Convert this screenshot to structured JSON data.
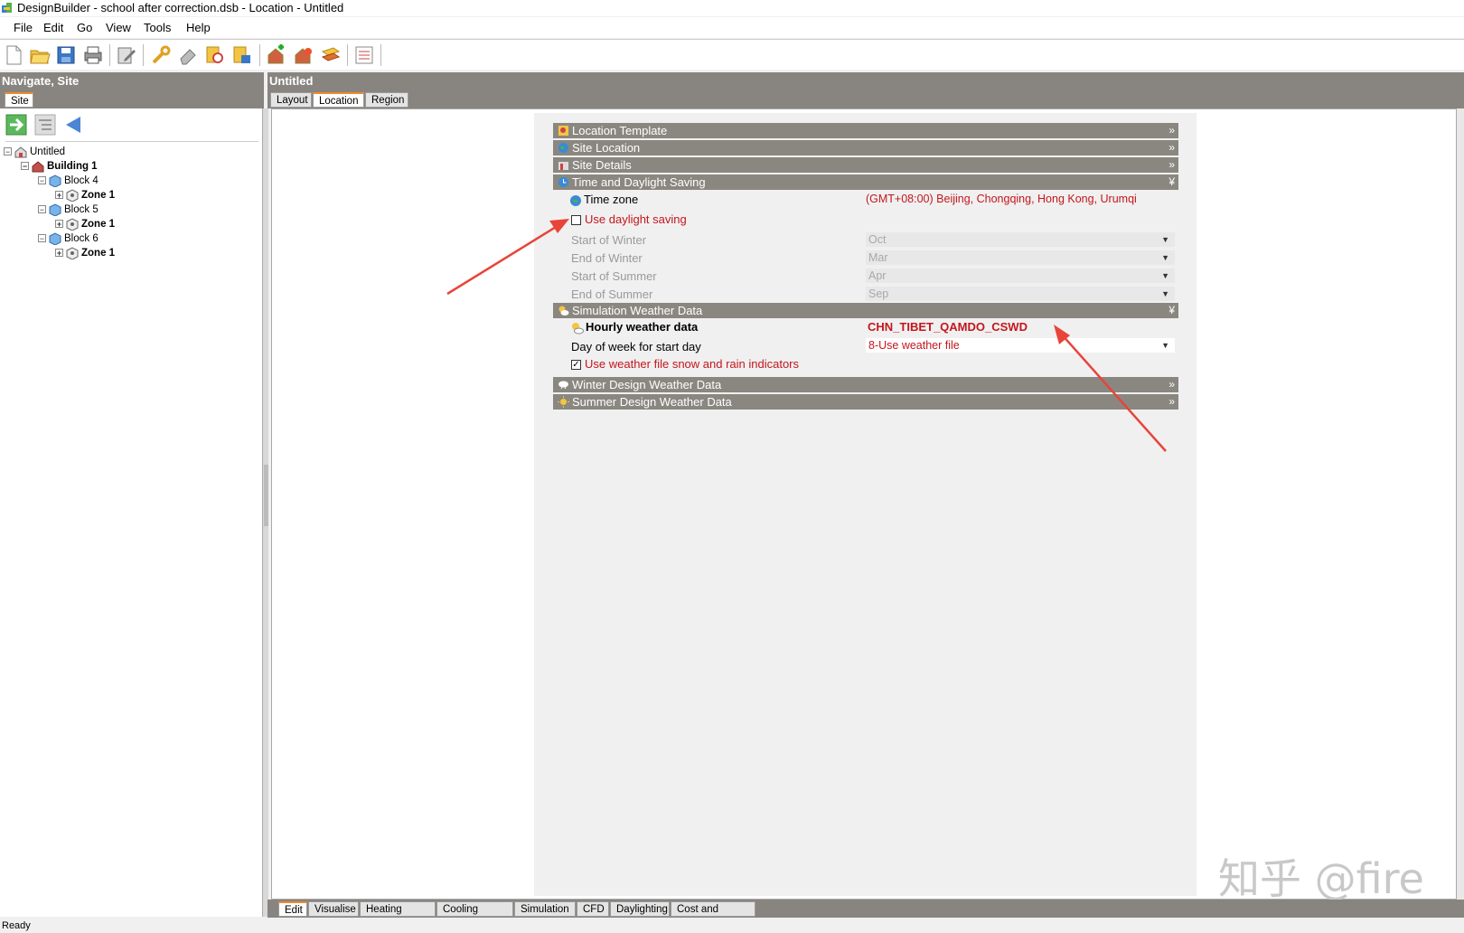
{
  "window": {
    "title": "DesignBuilder - school after correction.dsb - Location - Untitled"
  },
  "menu": [
    "File",
    "Edit",
    "Go",
    "View",
    "Tools",
    "Help"
  ],
  "toolbar_icons": [
    "new-icon",
    "open-icon",
    "save-icon",
    "print-icon",
    "edit-icon",
    "wrench-icon",
    "eraser-icon",
    "find-icon",
    "export-icon",
    "add-building-icon",
    "heat-icon",
    "cool-icon",
    "report-icon"
  ],
  "left": {
    "header": "Navigate, Site",
    "tab": "Site",
    "tree": [
      {
        "label": "Untitled",
        "bold": false
      },
      {
        "label": "Building 1",
        "bold": true
      },
      {
        "label": "Block 4",
        "bold": false
      },
      {
        "label": "Zone 1",
        "bold": true
      },
      {
        "label": "Block 5",
        "bold": false
      },
      {
        "label": "Zone 1",
        "bold": true
      },
      {
        "label": "Block 6",
        "bold": false
      },
      {
        "label": "Zone 1",
        "bold": true
      }
    ]
  },
  "right": {
    "header": "Untitled",
    "tabs": [
      "Layout",
      "Location",
      "Region"
    ],
    "active_tab": "Location"
  },
  "form": {
    "sections": {
      "location_template": "Location Template",
      "site_location": "Site Location",
      "site_details": "Site Details",
      "time_daylight": "Time and Daylight Saving",
      "sim_weather": "Simulation Weather Data",
      "winter_design": "Winter Design Weather Data",
      "summer_design": "Summer Design Weather Data"
    },
    "time_zone_label": "Time zone",
    "time_zone_value": "(GMT+08:00) Beijing, Chongqing, Hong Kong, Urumqi",
    "use_daylight_label": "Use daylight saving",
    "use_daylight_checked": false,
    "start_winter_label": "Start of Winter",
    "start_winter_value": "Oct",
    "end_winter_label": "End of Winter",
    "end_winter_value": "Mar",
    "start_summer_label": "Start of Summer",
    "start_summer_value": "Apr",
    "end_summer_label": "End of Summer",
    "end_summer_value": "Sep",
    "hourly_label": "Hourly weather data",
    "hourly_value": "CHN_TIBET_QAMDO_CSWD",
    "dow_label": "Day of week for start day",
    "dow_value": "8-Use weather file",
    "snow_rain_label": "Use weather file snow and rain indicators",
    "snow_rain_checked": true
  },
  "bottom_tabs": [
    "Edit",
    "Visualise",
    "Heating design",
    "Cooling design",
    "Simulation",
    "CFD",
    "Daylighting",
    "Cost and Carbon"
  ],
  "active_bottom_tab": "Edit",
  "status": "Ready",
  "watermark": "知乎 @fire",
  "colors": {
    "header_bg": "#888580",
    "accent_tab": "#f08a2c",
    "value_red": "#c4161c",
    "annotation_arrow": "#e8443a"
  }
}
